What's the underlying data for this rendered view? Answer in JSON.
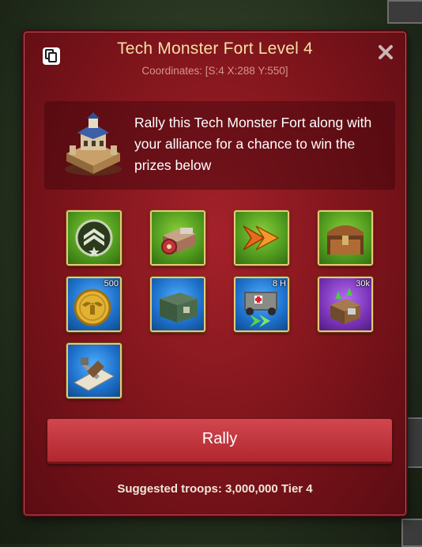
{
  "dialog": {
    "title": "Tech Monster Fort Level 4",
    "coordinates": "Coordinates: [S:4  X:288  Y:550]",
    "description": "Rally this Tech Monster Fort along with your alliance for a chance to win the prizes below",
    "rally_label": "Rally",
    "suggested": "Suggested troops: 3,000,000 Tier 4"
  },
  "rewards": [
    {
      "icon": "rank-insignia-icon",
      "frame": "green",
      "badge": ""
    },
    {
      "icon": "supply-crate-icon",
      "frame": "green",
      "badge": ""
    },
    {
      "icon": "speedup-arrows-icon",
      "frame": "green",
      "badge": ""
    },
    {
      "icon": "rusty-chest-icon",
      "frame": "green",
      "badge": ""
    },
    {
      "icon": "gold-coin-icon",
      "frame": "blue",
      "badge": "500"
    },
    {
      "icon": "steel-chest-icon",
      "frame": "blue",
      "badge": ""
    },
    {
      "icon": "healing-speedup-icon",
      "frame": "blue",
      "badge": "8 H"
    },
    {
      "icon": "resource-pack-icon",
      "frame": "purple",
      "badge": "30k"
    },
    {
      "icon": "blueprint-tools-icon",
      "frame": "blue",
      "badge": ""
    }
  ],
  "colors": {
    "panel": "#8f1a22",
    "title": "#f6dfa5",
    "button": "#c2363e",
    "reward_border": "#e7c877"
  }
}
